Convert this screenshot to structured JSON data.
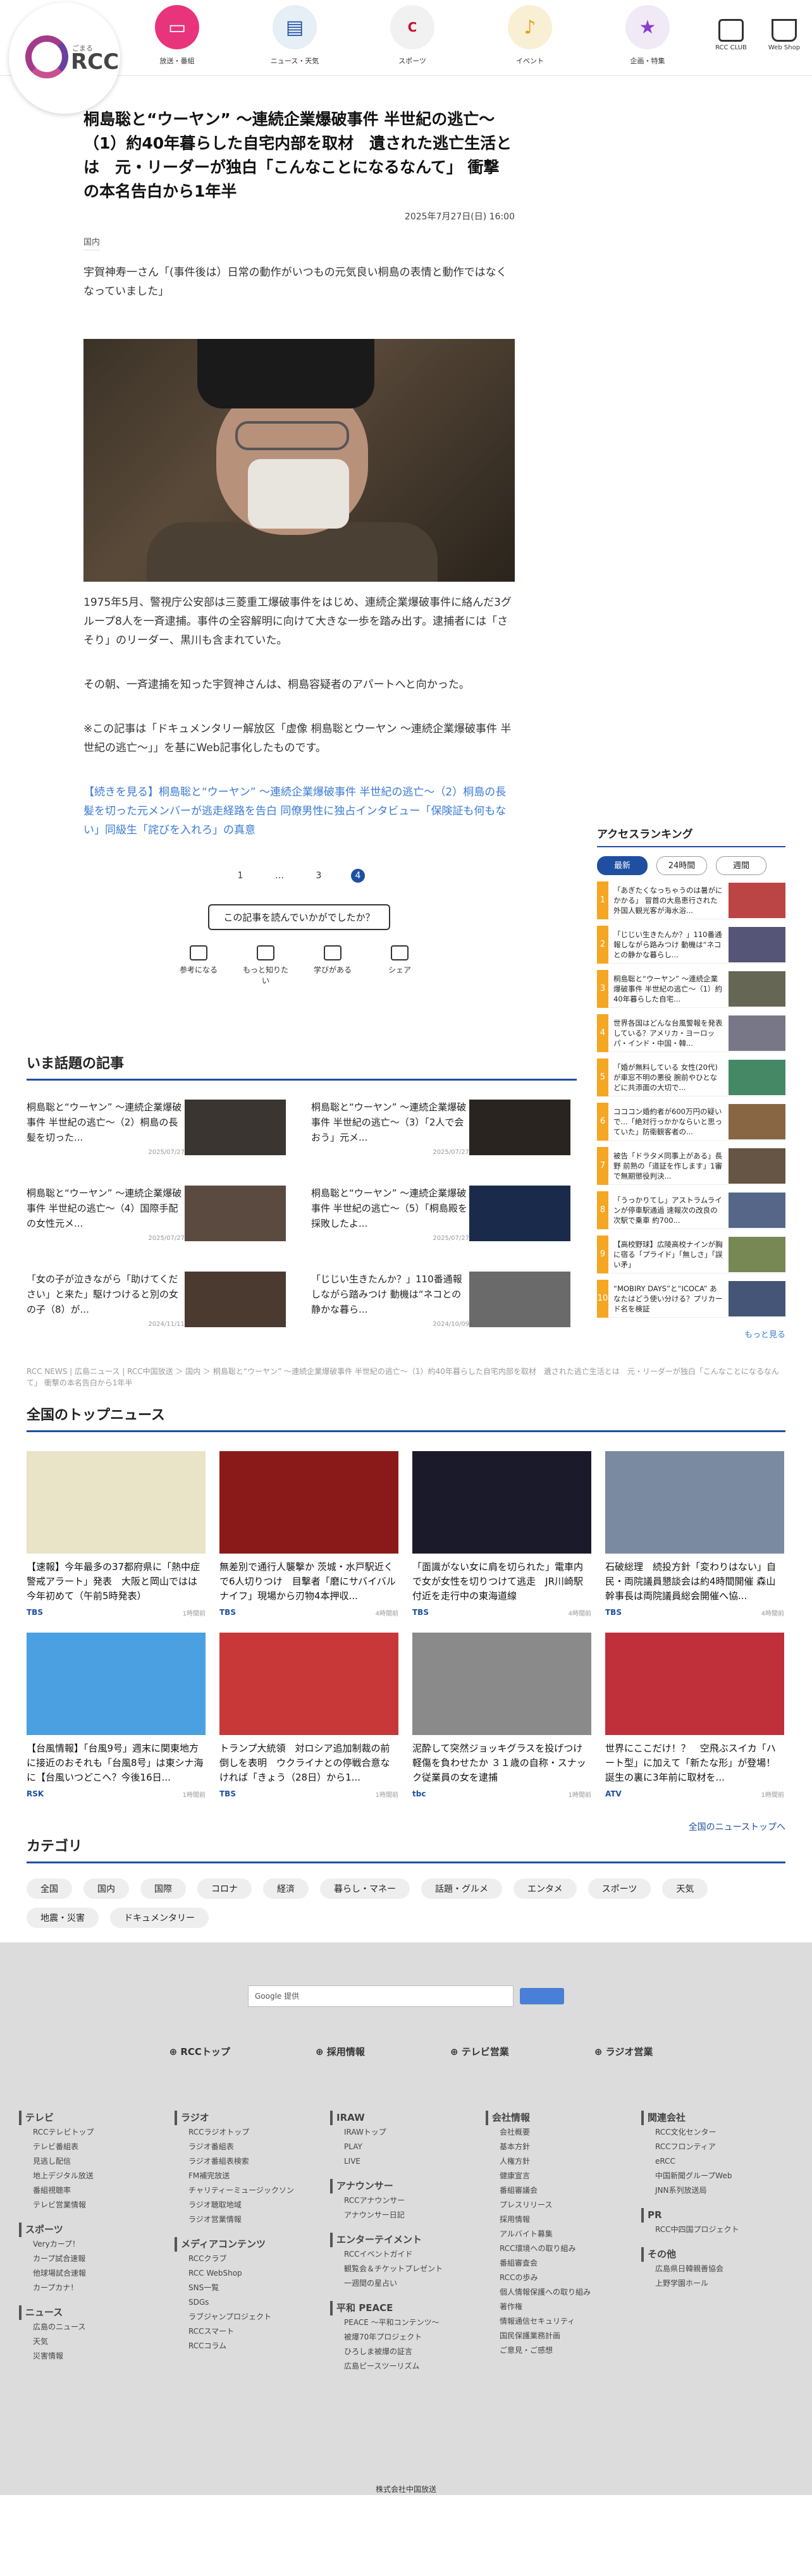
{
  "header": {
    "logo_text": "RCC",
    "logo_sub": "ごまる",
    "nav": [
      {
        "label": "放送・番組",
        "icon": "tv-icon",
        "color": "#e8347a"
      },
      {
        "label": "ニュース・天気",
        "icon": "newspaper-icon",
        "color": "#e6eef6"
      },
      {
        "label": "スポーツ",
        "icon": "carp-icon",
        "color": "#f1f1f1"
      },
      {
        "label": "イベント",
        "icon": "music-note-icon",
        "color": "#f8efd5"
      },
      {
        "label": "企画・特集",
        "icon": "star-icon",
        "color": "#f1eaf6"
      }
    ],
    "right_nav": [
      {
        "label": "RCC CLUB",
        "icon": "club-icon"
      },
      {
        "label": "Web Shop",
        "icon": "cart-icon"
      }
    ]
  },
  "article": {
    "title": "桐島聡と“ウーヤン” ～連続企業爆破事件 半世紀の逃亡～（1）約40年暮らした自宅内部を取材　遺された逃亡生活とは　元・リーダーが独白「こんなことになるなんて」 衝撃の本名告白から1年半",
    "date": "2025年7月27日(日) 16:00",
    "category": "国内",
    "lead": "宇賀神寿一さん「(事件後は）日常の動作がいつもの元気良い桐島の表情と動作ではなくなっていました」",
    "paragraphs": [
      "1975年5月、警視庁公安部は三菱重工爆破事件をはじめ、連続企業爆破事件に絡んだ3グループ8人を一斉逮捕。事件の全容解明に向けて大きな一歩を踏み出す。逮捕者には「さそり」のリーダー、黒川も含まれていた。",
      "その朝、一斉逮捕を知った宇賀神さんは、桐島容疑者のアパートへと向かった。",
      "※この記事は「ドキュメンタリー解放区「虚像 桐島聡とウーヤン ～連続企業爆破事件 半世紀の逃亡～」」を基にWeb記事化したものです。"
    ],
    "continue_link": "【続きを見る】桐島聡と“ウーヤン” ～連続企業爆破事件 半世紀の逃亡～（2）桐島の長髪を切った元メンバーが逃走経路を告白 同僚男性に独占インタビュー「保険証も何もない」同級生「詫びを入れろ」の真意",
    "pager": [
      "1",
      "…",
      "3",
      "4"
    ],
    "feedback_question": "この記事を読んでいかがでしたか？",
    "feedback": [
      "参考になる",
      "もっと知りたい",
      "学びがある",
      "シェア"
    ]
  },
  "ranking": {
    "title": "アクセスランキング",
    "tabs": [
      "最新",
      "24時間",
      "週間"
    ],
    "items": [
      "「あぎたくなっちゃうのは暑がにかかる」 冒首の大島恵行された外国人観光客が海水浴...",
      "「じじい生きたんか？」110番通報しながら路みつけ 動機は“ネコとの静かな暮らし...",
      "桐島聡と“ウーヤン” ～連続企業爆破事件 半世紀の逃亡～（1）約40年暮らした自宅...",
      "世界各国はどんな台風警報を発表している？アメリカ・ヨーロッパ・インド・中国・韓...",
      "「婚が無料している 女性(20代)が車窓不明の悪役 腕前やひとなどに共添面の大切で...",
      "コココン婚約者が600万円の疑いで...「絶対行っかかならいと思っていた」防衛観客者の...",
      "被告「ドラタメ同事上がある」長野 前熟の「道証を作します」1審で無期懲役判決...",
      "「うっかりてし」アストラムラインが停車駅通過 速報次の改良の次駅で乗車 約700...",
      "【高校野球】広陵高校ナインが胸に宿る「プライド」「無しさ」「誤い矛」",
      "“MOBIRY DAYS”と“ICOCA” あなたはどう使い分ける？プリカード名を検証"
    ],
    "more": "もっと見る"
  },
  "popular": {
    "title": "いま話題の記事",
    "items": [
      {
        "title": "桐島聡と“ウーヤン” ～連続企業爆破事件 半世紀の逃亡～（2）桐島の長髪を切った...",
        "date": "2025/07/27"
      },
      {
        "title": "桐島聡と“ウーヤン” ～連続企業爆破事件 半世紀の逃亡～（3）「2人で会おう」元メ...",
        "date": "2025/07/27"
      },
      {
        "title": "桐島聡と“ウーヤン” ～連続企業爆破事件 半世紀の逃亡～（4）国際手配の女性元メ...",
        "date": "2025/07/27"
      },
      {
        "title": "桐島聡と“ウーヤン” ～連続企業爆破事件 半世紀の逃亡～（5）「桐島殿を採敗したよ...",
        "date": "2025/07/27"
      },
      {
        "title": "「女の子が泣きながら「助けてください」と来た」駆けつけると別の女の子（8）が...",
        "date": "2024/11/11"
      },
      {
        "title": "「じじい生きたんか？」110番通報しながら踏みつけ 動機は“ネコとの静かな暮ら...",
        "date": "2024/10/09"
      }
    ]
  },
  "breadcrumb": "RCC NEWS | 広島ニュース | RCC中国放送 ＞ 国内 ＞ 桐島聡と“ウーヤン” ～連続企業爆破事件 半世紀の逃亡～（1）約40年暮らした自宅内部を取材　遺された逃亡生活とは　元・リーダーが独白「こんなことになるなんて」 衝撃の本名告白から1年半",
  "top_news": {
    "title": "全国のトップニュース",
    "items": [
      {
        "title": "【速報】今年最多の37都府県に「熱中症警戒アラート」発表　大阪と岡山ではは今年初めて（午前5時発表）",
        "source": "TBS",
        "time": "1時間前"
      },
      {
        "title": "無差別で通行人襲撃か 茨城・水戸駅近くで6人切りつけ　目撃者「磨にサバイバルナイフ」現場から刃物4本押収...",
        "source": "TBS",
        "time": "4時間前"
      },
      {
        "title": "「面識がない女に肩を切られた」電車内で女が女性を切りつけて逃走　JR川崎駅付近を走行中の東海道線",
        "source": "TBS",
        "time": "4時間前"
      },
      {
        "title": "石破総理　続投方針「変わりはない」自民・両院議員懇談会は約4時間開催 森山幹事長は両院議員総会開催へ協...",
        "source": "TBS",
        "time": "4時間前"
      },
      {
        "title": "【台風情報】「台風9号」週末に関東地方に接近のおそれも「台風8号」は東シナ海に【台風いつどこへ？今後16日...",
        "source": "RSK",
        "time": "1時間前"
      },
      {
        "title": "トランプ大統領　対ロシア追加制裁の前倒しを表明　ウクライナとの停戦合意なければ「きょう（28日）から1...",
        "source": "TBS",
        "time": "1時間前"
      },
      {
        "title": "泥酔して突然ジョッキグラスを投げつけ軽傷を負わせたか ３１歳の自称・スナック従業員の女を逮捕",
        "source": "tbc",
        "time": "1時間前"
      },
      {
        "title": "世界にここだけ！？　空飛ぶスイカ「ハート型」に加えて「新たな形」が登場！　誕生の裏に3年前に取材を...",
        "source": "ATV",
        "time": "1時間前"
      }
    ],
    "more": "全国のニューストップへ"
  },
  "categories": {
    "title": "カテゴリ",
    "items": [
      "全国",
      "国内",
      "国際",
      "コロナ",
      "経済",
      "暮らし・マネー",
      "話題・グルメ",
      "エンタメ",
      "スポーツ",
      "天気",
      "地震・災害",
      "ドキュメンタリー"
    ]
  },
  "footer": {
    "search_placeholder": "Google 提供",
    "links": [
      "RCCトップ",
      "採用情報",
      "テレビ営業",
      "ラジオ営業"
    ],
    "columns": [
      [
        {
          "head": "テレビ",
          "items": [
            "RCCテレビトップ",
            "テレビ番組表",
            "見逃し配信",
            "地上デジタル放送",
            "番組視聴率",
            "テレビ営業情報"
          ]
        },
        {
          "head": "スポーツ",
          "items": [
            "Veryカープ！",
            "カープ試合速報",
            "他球場試合速報",
            "カープカナ！"
          ]
        },
        {
          "head": "ニュース",
          "items": [
            "広島のニュース",
            "天気",
            "災害情報"
          ]
        }
      ],
      [
        {
          "head": "ラジオ",
          "items": [
            "RCCラジオトップ",
            "ラジオ番組表",
            "ラジオ番組表検索",
            "FM補完放送",
            "チャリティーミュージックソン",
            "ラジオ聴取地域",
            "ラジオ営業情報"
          ]
        },
        {
          "head": "メディアコンテンツ",
          "items": [
            "RCCクラブ",
            "RCC WebShop",
            "SNS一覧",
            "SDGs",
            "ラブジャンプロジェクト",
            "RCCスマート",
            "RCCコラム"
          ]
        }
      ],
      [
        {
          "head": "IRAW",
          "items": [
            "IRAWトップ",
            "PLAY",
            "LIVE"
          ]
        },
        {
          "head": "アナウンサー",
          "items": [
            "RCCアナウンサー",
            "アナウンサー日記"
          ]
        },
        {
          "head": "エンターテイメント",
          "items": [
            "RCCイベントガイド",
            "観覧会＆チケットプレゼント",
            "一週間の星占い"
          ]
        },
        {
          "head": "平和 PEACE",
          "items": [
            "PEACE ～平和コンテンツ～",
            "被爆70年プロジェクト",
            "ひろしま被爆の証言",
            "広島ピースツーリズム"
          ]
        }
      ],
      [
        {
          "head": "会社情報",
          "items": [
            "会社概要",
            "基本方針",
            "人権方針",
            "健康宣言",
            "番組審議会",
            "プレスリリース",
            "採用情報",
            "アルバイト募集",
            "RCC環境への取り組み",
            "番組審査会",
            "RCCの歩み",
            "個人情報保護への取り組み",
            "著作権",
            "情報通信セキュリティ",
            "国民保護業務計画",
            "ご意見・ご感想"
          ]
        }
      ],
      [
        {
          "head": "関連会社",
          "items": [
            "RCC文化センター",
            "RCCフロンティア",
            "eRCC",
            "中国新聞グループWeb",
            "JNN系列放送局"
          ]
        },
        {
          "head": "PR",
          "items": [
            "RCC中四国プロジェクト"
          ]
        },
        {
          "head": "その他",
          "items": [
            "広島県日韓親善協会",
            "上野学園ホール"
          ]
        }
      ]
    ],
    "copyright": "株式会社中国放送"
  }
}
